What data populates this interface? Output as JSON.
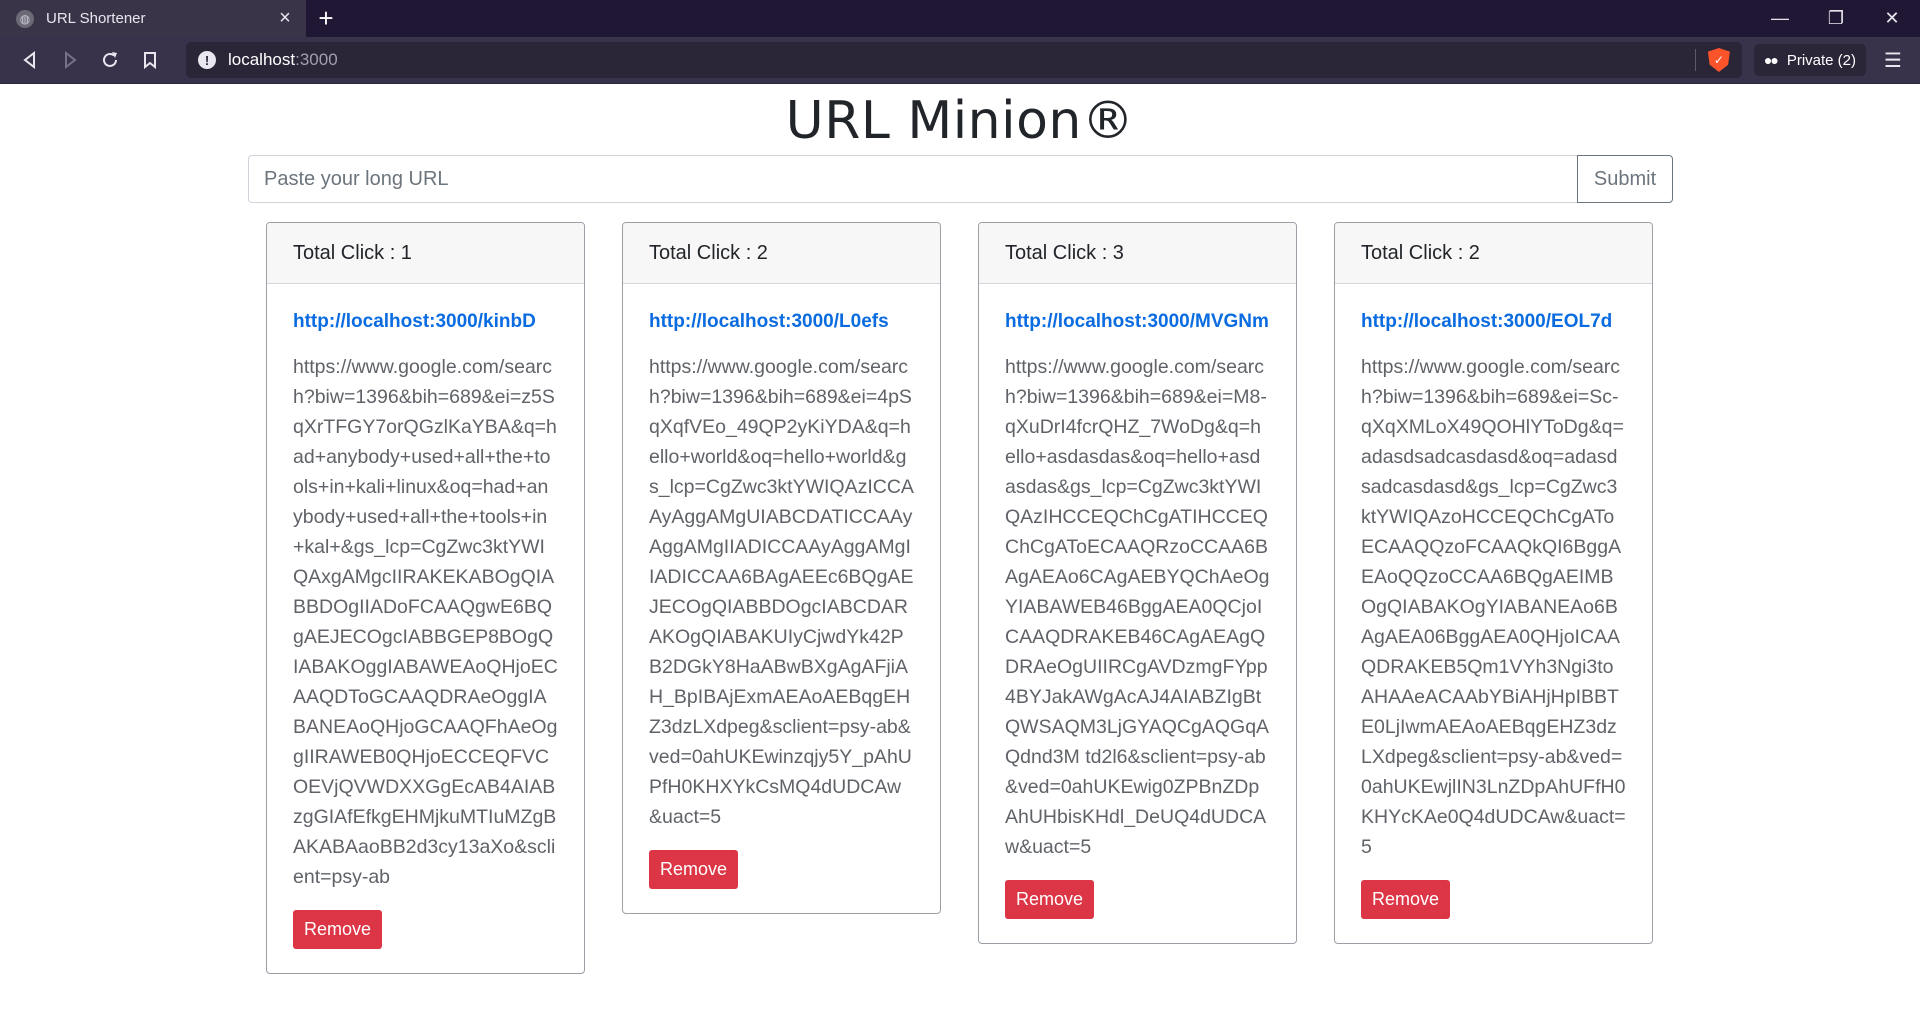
{
  "browser": {
    "tab_title": "URL Shortener",
    "tab_close": "×",
    "new_tab": "+",
    "url_host": "localhost",
    "url_port": ":3000",
    "private_label": "Private (2)",
    "controls": {
      "minimize": "—",
      "restore": "❐",
      "close": "✕"
    }
  },
  "page": {
    "title": "URL Minion®",
    "search": {
      "placeholder": "Paste your long URL",
      "value": ""
    },
    "submit_label": "Submit",
    "remove_label": "Remove"
  },
  "cards": [
    {
      "clicks": "Total Click : 1",
      "short_url": "http://localhost:3000/kinbD",
      "long_url": "https://www.google.com/search?biw=1396&bih=689&ei=z5SqXrTFGY7orQGzlKaYBA&q=had+anybody+used+all+the+tools+in+kali+linux&oq=had+anybody+used+all+the+tools+in+kal+&gs_lcp=CgZwc3ktYWIQAxgAMgcIIRAKEKABOgQIABBDOgIIADoFCAAQgwE6BQgAEJECOgcIABBGEP8BOgQIABAKOggIABAWEAoQHjoECAAQDToGCAAQDRAeOggIABANEAoQHjoGCAAQFhAeOggIIRAWEB0QHjoECCEQFVCOEVjQVWDXXGgEcAB4AIABzgGIAfEfkgEHMjkuMTIuMZgBAKABAaoBB2d3cy13aXo&sclient=psy-ab"
    },
    {
      "clicks": "Total Click : 2",
      "short_url": "http://localhost:3000/L0efs",
      "long_url": "https://www.google.com/search?biw=1396&bih=689&ei=4pSqXqfVEo_49QP2yKiYDA&q=hello+world&oq=hello+world&gs_lcp=CgZwc3ktYWIQAzICCAAyAggAMgUIABCDATICCAAyAggAMgIIADICCAAyAggAMgIIADICCAA6BAgAEEc6BQgAEJECOgQIABBDOgcIABCDARAKOgQIABAKUIyCjwdYk42PB2DGkY8HaABwBXgAgAFjiAH_BpIBAjExmAEAoAEBqgEHZ3dzLXdpeg&sclient=psy-ab&ved=0ahUKEwinzqjy5Y_pAhUPfH0KHXYkCsMQ4dUDCAw&uact=5"
    },
    {
      "clicks": "Total Click : 3",
      "short_url": "http://localhost:3000/MVGNm",
      "long_url": "https://www.google.com/search?biw=1396&bih=689&ei=M8-qXuDrI4fcrQHZ_7WoDg&q=hello+asdasdas&oq=hello+asdasdas&gs_lcp=CgZwc3ktYWIQAzIHCCEQChCgATIHCCEQChCgAToECAAQRzoCCAA6BAgAEAo6CAgAEBYQChAeOgYIABAWEB46BggAEA0QCjoICAAQDRAKEB46CAgAEAgQDRAeOgUIIRCgAVDzmgFYpp4BYJakAWgAcAJ4AIABZIgBtQWSAQM3LjGYAQCgAQGqAQdnd3M td2l6&sclient=psy-ab&ved=0ahUKEwig0ZPBnZDpAhUHbisKHdl_DeUQ4dUDCAw&uact=5"
    },
    {
      "clicks": "Total Click : 2",
      "short_url": "http://localhost:3000/EOL7d",
      "long_url": "https://www.google.com/search?biw=1396&bih=689&ei=Sc-qXqXMLoX49QOHlYToDg&q=adasdsadcasdasd&oq=adasdsadcasdasd&gs_lcp=CgZwc3ktYWIQAzoHCCEQChCgAToECAAQQzoFCAAQkQI6BggAEAoQQzoCCAA6BQgAEIMBOgQIABAKOgYIABANEAo6BAgAEA06BggAEA0QHjoICAAQDRAKEB5Qm1VYh3Ngi3toAHAAeACAAbYBiAHjHpIBBTE0LjIwmAEAoAEBqgEHZ3dzLXdpeg&sclient=psy-ab&ved=0ahUKEwjlIN3LnZDpAhUFfH0KHYcKAe0Q4dUDCAw&uact=5"
    }
  ]
}
